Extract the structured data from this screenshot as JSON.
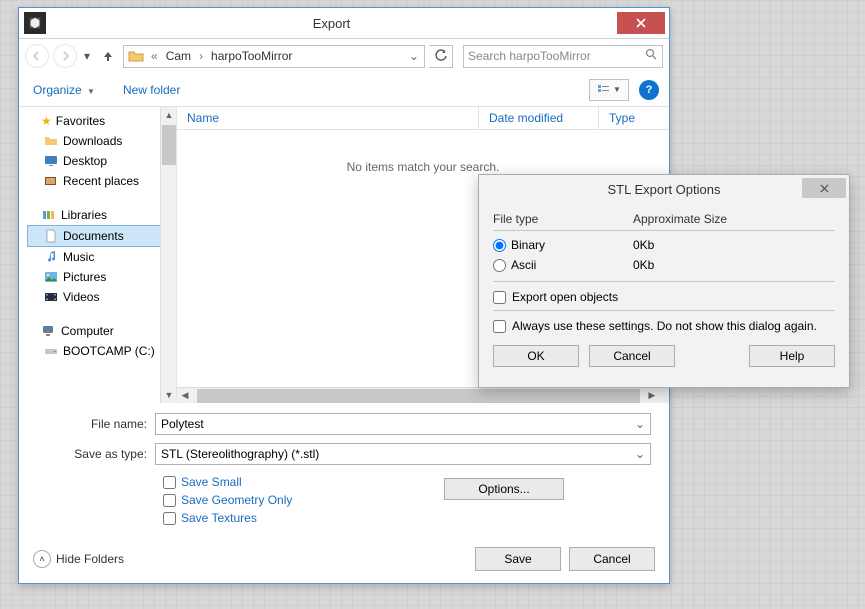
{
  "window": {
    "title": "Export"
  },
  "nav": {
    "path_prefix": "«",
    "seg1": "Cam",
    "seg2": "harpoTooMirror",
    "search_placeholder": "Search harpoTooMirror"
  },
  "toolbar": {
    "organize": "Organize",
    "new_folder": "New folder"
  },
  "tree": {
    "favorites": "Favorites",
    "downloads": "Downloads",
    "desktop": "Desktop",
    "recent": "Recent places",
    "libraries": "Libraries",
    "documents": "Documents",
    "music": "Music",
    "pictures": "Pictures",
    "videos": "Videos",
    "computer": "Computer",
    "bootcamp": "BOOTCAMP (C:)"
  },
  "columns": {
    "name": "Name",
    "date": "Date modified",
    "type": "Type"
  },
  "empty": "No items match your search.",
  "form": {
    "file_name_label": "File name:",
    "file_name": "Polytest",
    "save_type_label": "Save as type:",
    "save_type": "STL (Stereolithography) (*.stl)"
  },
  "checks": {
    "save_small": "Save Small",
    "save_geom": "Save Geometry Only",
    "save_tex": "Save Textures"
  },
  "options_btn": "Options...",
  "hide_folders": "Hide Folders",
  "save": "Save",
  "cancel": "Cancel",
  "stl": {
    "title": "STL Export Options",
    "file_type": "File type",
    "approx": "Approximate Size",
    "binary": "Binary",
    "binary_size": "0Kb",
    "ascii": "Ascii",
    "ascii_size": "0Kb",
    "export_open": "Export open objects",
    "always": "Always use these settings. Do not show this dialog again.",
    "ok": "OK",
    "cancel": "Cancel",
    "help": "Help"
  }
}
